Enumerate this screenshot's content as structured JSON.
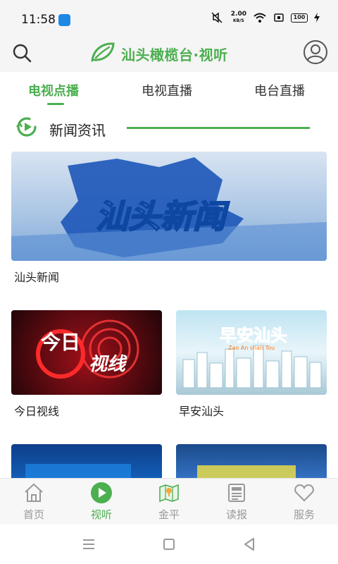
{
  "status": {
    "time": "11:58",
    "speed_value": "2.00",
    "speed_unit": "KB/S",
    "battery": "100"
  },
  "header": {
    "title": "汕头橄榄台·视听"
  },
  "tabs": [
    {
      "label": "电视点播"
    },
    {
      "label": "电视直播"
    },
    {
      "label": "电台直播"
    }
  ],
  "section": {
    "title": "新闻资讯"
  },
  "cards": [
    {
      "label": "汕头新闻",
      "overlay_text": "汕头新闻"
    },
    {
      "label": "今日视线",
      "overlay_text_a": "今日",
      "overlay_text_b": "视线"
    },
    {
      "label": "早安汕头",
      "overlay_text": "早安汕头",
      "overlay_sub": "Zao An shan Tou"
    }
  ],
  "bottom_nav": [
    {
      "label": "首页",
      "icon": "home-icon"
    },
    {
      "label": "视听",
      "icon": "play-circle-icon"
    },
    {
      "label": "金平",
      "icon": "map-icon"
    },
    {
      "label": "读报",
      "icon": "newspaper-icon"
    },
    {
      "label": "服务",
      "icon": "heart-icon"
    }
  ],
  "colors": {
    "accent": "#4caf50",
    "inactive": "#999999"
  }
}
